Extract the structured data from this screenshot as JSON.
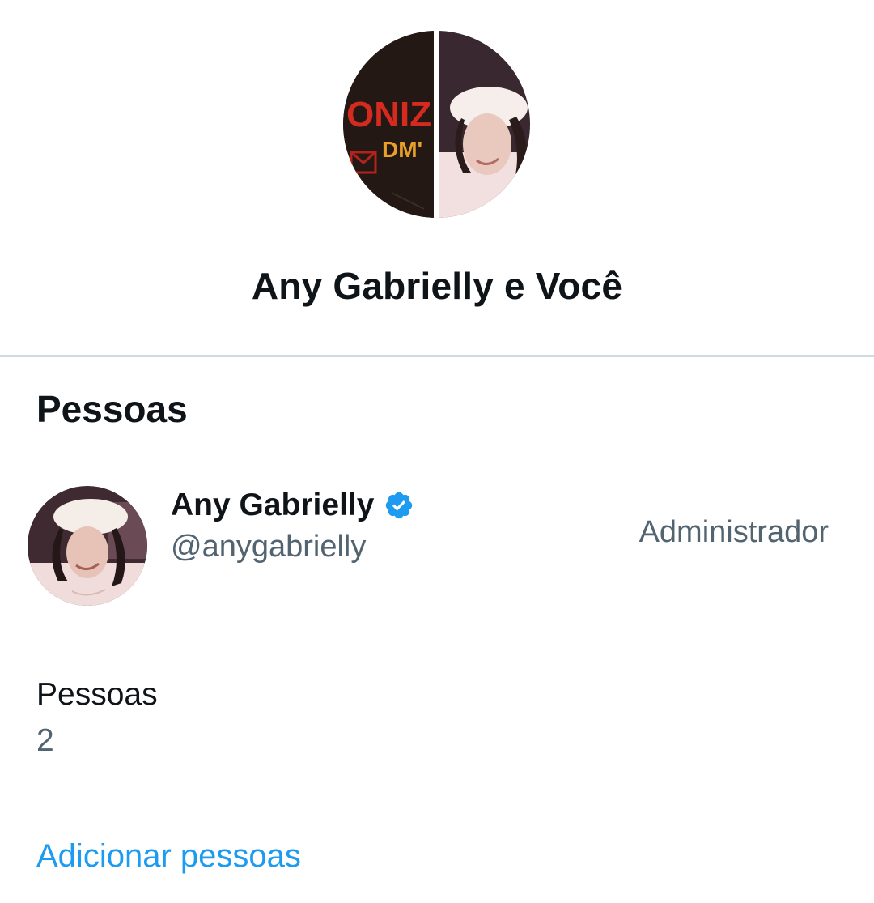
{
  "header": {
    "title": "Any Gabrielly e Você",
    "avatar_left_text": "ONIZ",
    "avatar_left_subtext": "DM'"
  },
  "people_section": {
    "title": "Pessoas",
    "members": [
      {
        "name": "Any Gabrielly",
        "handle": "@anygabrielly",
        "role": "Administrador",
        "verified": true
      }
    ]
  },
  "summary": {
    "label": "Pessoas",
    "count": "2"
  },
  "actions": {
    "add_people": "Adicionar pessoas"
  },
  "colors": {
    "accent": "#1d9bf0",
    "primary_text": "#0f1419",
    "secondary_text": "#536471",
    "divider": "#cfd9de"
  }
}
